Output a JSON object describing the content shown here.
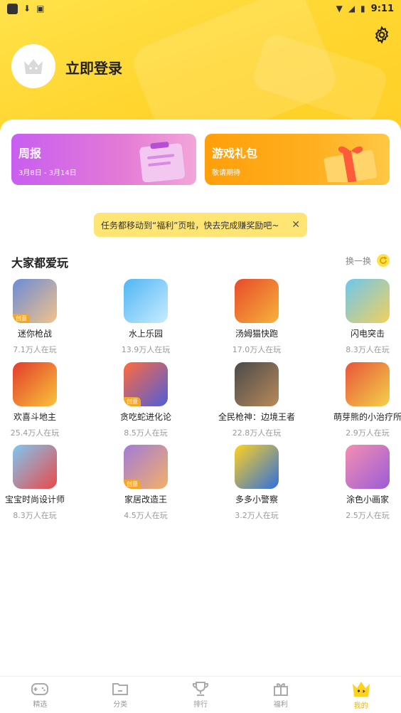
{
  "status_bar": {
    "time": "9:11"
  },
  "header": {
    "login_label": "立即登录"
  },
  "cards": {
    "weekly": {
      "title": "周报",
      "subtitle": "3月8日 - 3月14日"
    },
    "gift": {
      "title": "游戏礼包",
      "subtitle": "敬请期待"
    }
  },
  "notice": {
    "text": "任务都移动到“福利”页啦，快去完成赚奖励吧~"
  },
  "section": {
    "title": "大家都爱玩",
    "refresh_label": "换一换"
  },
  "games": [
    {
      "name": "迷你枪战",
      "players": "7.1万人在玩",
      "badge": "创意",
      "colors": [
        "#6b8bd6",
        "#f2c38a"
      ]
    },
    {
      "name": "水上乐园",
      "players": "13.9万人在玩",
      "badge": "",
      "colors": [
        "#4fb5f5",
        "#c8ecff"
      ]
    },
    {
      "name": "汤姆猫快跑",
      "players": "17.0万人在玩",
      "badge": "",
      "colors": [
        "#e84a2b",
        "#f6b33c"
      ]
    },
    {
      "name": "闪电突击",
      "players": "8.3万人在玩",
      "badge": "",
      "colors": [
        "#6cc7ef",
        "#f2d15a"
      ]
    },
    {
      "name": "欢喜斗地主",
      "players": "25.4万人在玩",
      "badge": "",
      "colors": [
        "#e33b2e",
        "#f9c43a"
      ]
    },
    {
      "name": "贪吃蛇进化论",
      "players": "8.5万人在玩",
      "badge": "创意",
      "colors": [
        "#ff6b3d",
        "#4f5ed9"
      ]
    },
    {
      "name": "全民枪神：边境王者",
      "players": "22.8万人在玩",
      "badge": "",
      "colors": [
        "#4a4a4a",
        "#b88a5a"
      ]
    },
    {
      "name": "萌芽熊的小治疗所",
      "players": "2.9万人在玩",
      "badge": "",
      "colors": [
        "#e8533a",
        "#f4d24a"
      ]
    },
    {
      "name": "宝宝时尚设计师",
      "players": "8.3万人在玩",
      "badge": "",
      "colors": [
        "#7fc7f2",
        "#e84a4a"
      ]
    },
    {
      "name": "家居改造王",
      "players": "4.5万人在玩",
      "badge": "创意",
      "colors": [
        "#a27bd8",
        "#f2b068"
      ]
    },
    {
      "name": "多多小警察",
      "players": "3.2万人在玩",
      "badge": "",
      "colors": [
        "#ffd21f",
        "#2f6fe0"
      ]
    },
    {
      "name": "涂色小画家",
      "players": "2.5万人在玩",
      "badge": "",
      "colors": [
        "#f48fb1",
        "#9c5bd6"
      ]
    }
  ],
  "tabs": [
    {
      "label": "精选",
      "icon": "gamepad-icon"
    },
    {
      "label": "分类",
      "icon": "folder-icon"
    },
    {
      "label": "排行",
      "icon": "trophy-icon"
    },
    {
      "label": "福利",
      "icon": "gift-icon"
    },
    {
      "label": "我的",
      "icon": "crown-mascot-icon"
    }
  ],
  "colors": {
    "accent": "#ffd52e",
    "active_tab": "#f3b300"
  }
}
